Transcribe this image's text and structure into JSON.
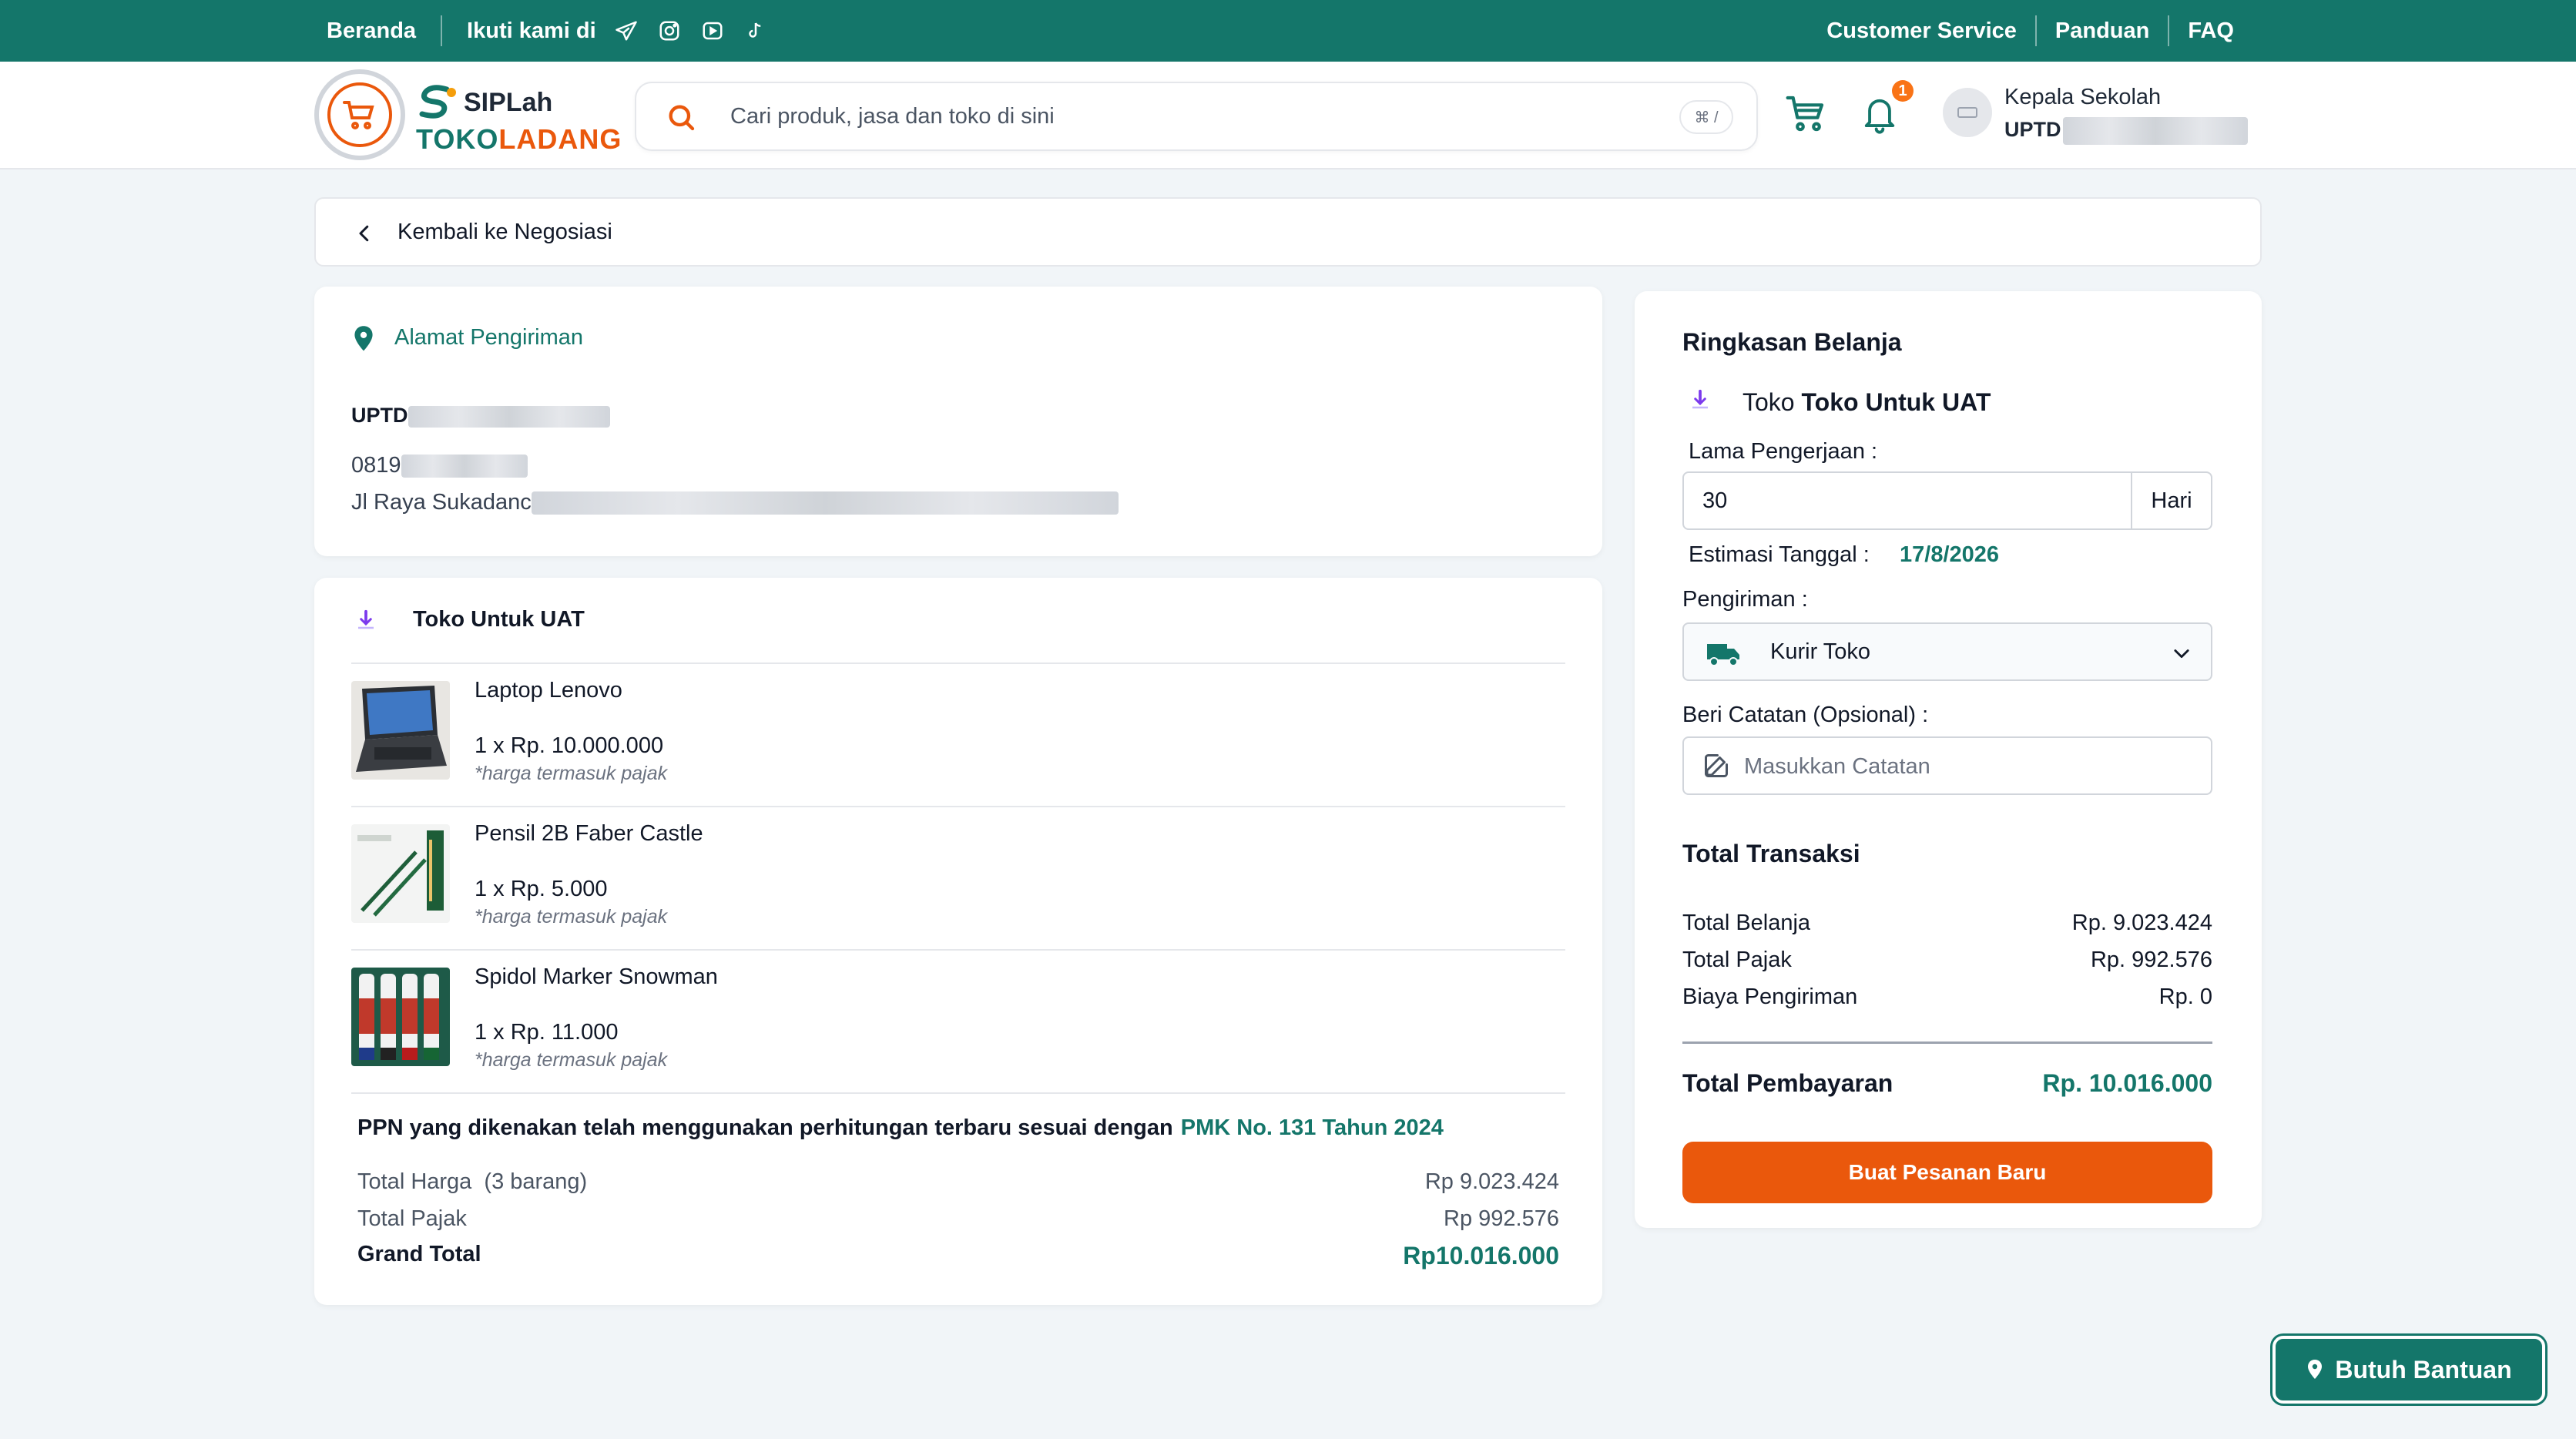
{
  "topbar": {
    "home": "Beranda",
    "follow": "Ikuti kami di",
    "social": [
      "telegram-icon",
      "instagram-icon",
      "youtube-icon",
      "tiktok-icon"
    ],
    "customer_service": "Customer Service",
    "guide": "Panduan",
    "faq": "FAQ"
  },
  "header": {
    "brand_top": "SIPLah",
    "brand_bottom_1": "TOKO",
    "brand_bottom_2": "LADANG",
    "search_placeholder": "Cari produk, jasa dan toko di sini",
    "search_shortcut": "⌘ /",
    "notification_count": "1",
    "user_role": "Kepala Sekolah",
    "user_org": "UPTD"
  },
  "back": {
    "label": "Kembali ke Negosiasi"
  },
  "address": {
    "title": "Alamat Pengiriman",
    "name": "UPTD",
    "phone": "0819",
    "street": "Jl Raya Sukadanc"
  },
  "order": {
    "shop_name": "Toko Untuk UAT",
    "items": [
      {
        "name": "Laptop Lenovo",
        "qty": "1 x Rp. 10.000.000",
        "tax_note": "*harga termasuk pajak"
      },
      {
        "name": "Pensil 2B Faber Castle",
        "qty": "1 x Rp. 5.000",
        "tax_note": "*harga termasuk pajak"
      },
      {
        "name": "Spidol Marker Snowman",
        "qty": "1 x Rp. 11.000",
        "tax_note": "*harga termasuk pajak"
      }
    ],
    "ppn_text": "PPN yang dikenakan telah menggunakan perhitungan terbaru sesuai dengan",
    "ppn_link": "PMK No. 131 Tahun 2024",
    "total_price_label": "Total Harga  (3 barang)",
    "total_price": "Rp 9.023.424",
    "total_tax_label": "Total Pajak",
    "total_tax": "Rp 992.576",
    "grand_total_label": "Grand Total",
    "grand_total": "Rp10.016.000"
  },
  "summary": {
    "title": "Ringkasan Belanja",
    "shop_prefix": "Toko",
    "shop_name": "Toko Untuk UAT",
    "duration_label": "Lama Pengerjaan :",
    "duration_value": "30",
    "duration_unit": "Hari",
    "est_label": "Estimasi Tanggal :",
    "est_date": "17/8/2026",
    "shipping_label": "Pengiriman :",
    "shipping_value": "Kurir Toko",
    "note_label": "Beri Catatan (Opsional) :",
    "note_placeholder": "Masukkan Catatan",
    "transaction_title": "Total Transaksi",
    "rows": [
      {
        "label": "Total Belanja",
        "value": "Rp. 9.023.424"
      },
      {
        "label": "Total Pajak",
        "value": "Rp. 992.576"
      },
      {
        "label": "Biaya Pengiriman",
        "value": "Rp. 0"
      }
    ],
    "payment_label": "Total Pembayaran",
    "payment_value": "Rp. 10.016.000",
    "order_button": "Buat Pesanan Baru"
  },
  "help": {
    "label": "Butuh Bantuan"
  },
  "colors": {
    "primary": "#14766a",
    "accent": "#ea580c",
    "background": "#f1f5f8"
  }
}
